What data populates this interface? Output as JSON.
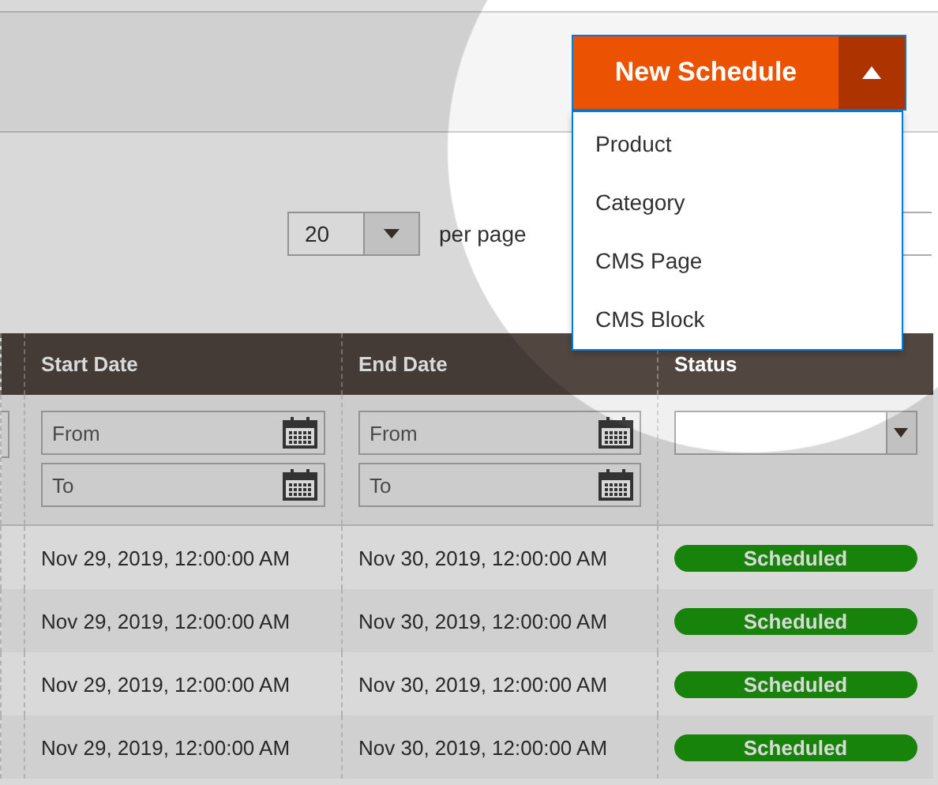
{
  "new_schedule": {
    "label": "New Schedule",
    "expanded": true,
    "menu": [
      "Product",
      "Category",
      "CMS Page",
      "CMS Block"
    ]
  },
  "pager": {
    "per_page_value": "20",
    "per_page_label": "per page"
  },
  "table": {
    "columns": [
      "Start Date",
      "End Date",
      "Status"
    ],
    "filters": {
      "start": {
        "from_placeholder": "From",
        "to_placeholder": "To"
      },
      "end": {
        "from_placeholder": "From",
        "to_placeholder": "To"
      }
    },
    "rows": [
      {
        "start": "Nov 29, 2019, 12:00:00 AM",
        "end": "Nov 30, 2019, 12:00:00 AM",
        "status": "Scheduled"
      },
      {
        "start": "Nov 29, 2019, 12:00:00 AM",
        "end": "Nov 30, 2019, 12:00:00 AM",
        "status": "Scheduled"
      },
      {
        "start": "Nov 29, 2019, 12:00:00 AM",
        "end": "Nov 30, 2019, 12:00:00 AM",
        "status": "Scheduled"
      },
      {
        "start": "Nov 29, 2019, 12:00:00 AM",
        "end": "Nov 30, 2019, 12:00:00 AM",
        "status": "Scheduled"
      }
    ]
  }
}
